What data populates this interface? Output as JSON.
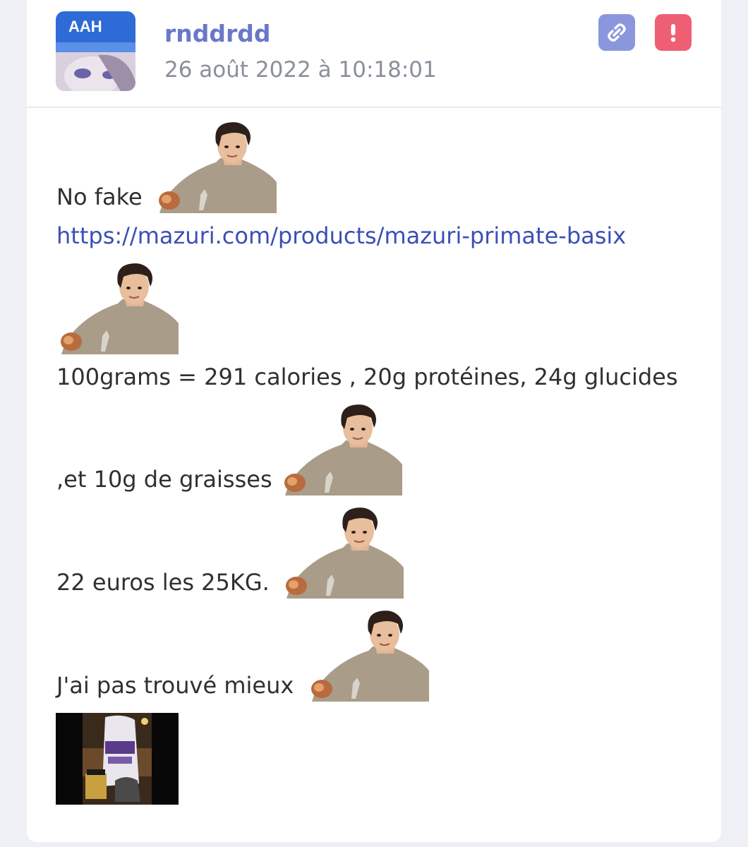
{
  "post": {
    "author": "rnddrdd",
    "date": "26 août 2022 à 10:18:01",
    "avatar_label": "AAH",
    "actions": {
      "link_icon": "link-icon",
      "report_icon": "exclamation-icon"
    },
    "lines": {
      "no_fake": "No fake",
      "url": "https://mazuri.com/products/mazuri-primate-basix",
      "nutrition": "100grams = 291 calories , 20g protéines, 24g glucides",
      "fat": ",et 10g de graisses",
      "price": "22 euros les 25KG.",
      "conclusion": "J'ai pas trouvé mieux"
    },
    "colors": {
      "author": "#6a78c9",
      "link": "#3b4fb6",
      "link_button": "#8b97dd",
      "report_button": "#ef5f74"
    }
  }
}
